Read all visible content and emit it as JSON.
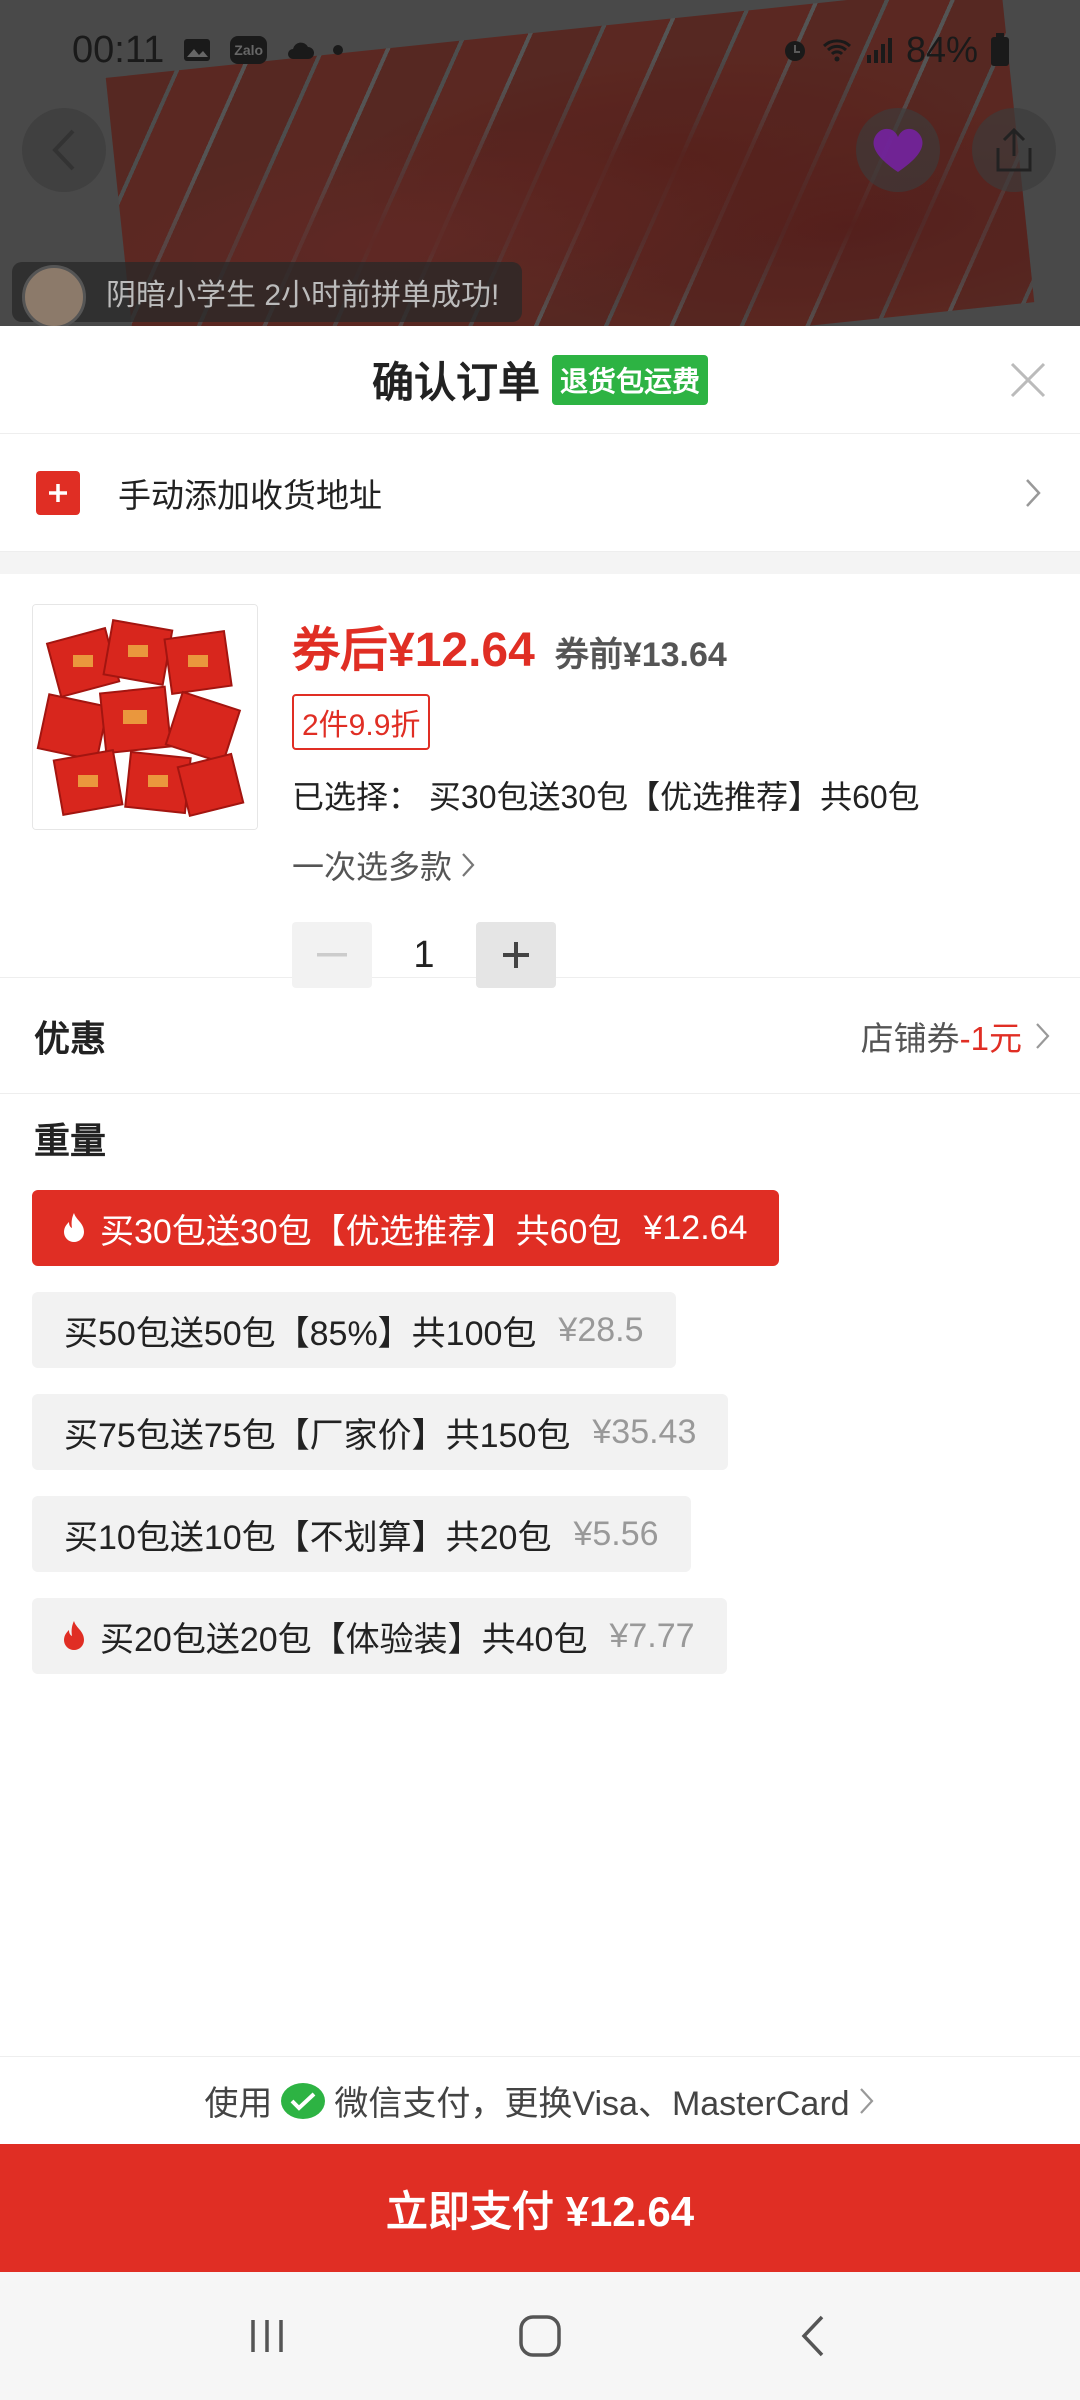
{
  "status_bar": {
    "time": "00:11",
    "zalo_label": "Zalo",
    "battery": "84%"
  },
  "background": {
    "group_buy_notice": "阴暗小学生 2小时前拼单成功!"
  },
  "sheet": {
    "title": "确认订单",
    "return_badge": "退货包运费"
  },
  "address": {
    "label": "手动添加收货地址"
  },
  "product": {
    "price_after": "券后¥12.64",
    "price_before": "券前¥13.64",
    "discount_tag": "2件9.9折",
    "selected": "已选择： 买30包送30包【优选推荐】共60包",
    "multi_select": "一次选多款",
    "quantity": "1"
  },
  "promo": {
    "label": "优惠",
    "coupon_prefix": "店铺券",
    "coupon_amount": "-1元"
  },
  "weight": {
    "title": "重量",
    "options": [
      {
        "label": "买30包送30包【优选推荐】共60包",
        "price": "¥12.64",
        "selected": true,
        "hot": true
      },
      {
        "label": "买50包送50包【85%】共100包",
        "price": "¥28.5",
        "selected": false,
        "hot": false
      },
      {
        "label": "买75包送75包【厂家价】共150包",
        "price": "¥35.43",
        "selected": false,
        "hot": false
      },
      {
        "label": "买10包送10包【不划算】共20包",
        "price": "¥5.56",
        "selected": false,
        "hot": false
      },
      {
        "label": "买20包送20包【体验装】共40包",
        "price": "¥7.77",
        "selected": false,
        "hot": true
      }
    ]
  },
  "payment": {
    "use_prefix": "使用",
    "method_text": "微信支付，更换Visa、MasterCard",
    "pay_button": "立即支付 ¥12.64"
  },
  "colors": {
    "accent": "#e02e24",
    "badge_green": "#2db343",
    "wechat_green": "#2db343"
  }
}
